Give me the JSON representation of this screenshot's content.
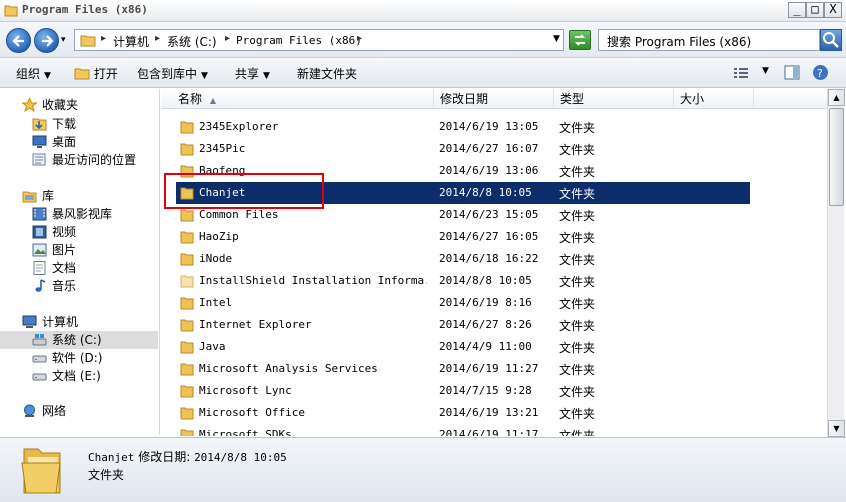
{
  "window": {
    "title": "Program Files (x86)",
    "buttons": {
      "minimize": "_",
      "maximize": "□",
      "close": "X"
    }
  },
  "address": {
    "crumbs": [
      "计算机",
      "系统 (C:)",
      "Program Files (x86)"
    ],
    "search_placeholder": "搜索 Program Files (x86)"
  },
  "toolbar": {
    "organize": "组织",
    "open": "打开",
    "include_in_library": "包含到库中",
    "share": "共享",
    "new_folder": "新建文件夹"
  },
  "nav": {
    "favorites": "收藏夹",
    "downloads": "下载",
    "desktop": "桌面",
    "recent": "最近访问的位置",
    "libraries": "库",
    "videos_lib": "暴风影视库",
    "video": "视频",
    "pictures": "图片",
    "documents": "文档",
    "music": "音乐",
    "computer": "计算机",
    "drive_c": "系统 (C:)",
    "drive_d": "软件 (D:)",
    "drive_e": "文档 (E:)",
    "network": "网络"
  },
  "columns": {
    "name": "名称",
    "modified": "修改日期",
    "type": "类型",
    "size": "大小"
  },
  "files": [
    {
      "name": "2345Explorer",
      "date": "2014/6/19 13:05",
      "type": "文件夹"
    },
    {
      "name": "2345Pic",
      "date": "2014/6/27 16:07",
      "type": "文件夹"
    },
    {
      "name": "Baofeng",
      "date": "2014/6/19 13:06",
      "type": "文件夹"
    },
    {
      "name": "Chanjet",
      "date": "2014/8/8 10:05",
      "type": "文件夹"
    },
    {
      "name": "Common Files",
      "date": "2014/6/23 15:05",
      "type": "文件夹"
    },
    {
      "name": "HaoZip",
      "date": "2014/6/27 16:05",
      "type": "文件夹"
    },
    {
      "name": "iNode",
      "date": "2014/6/18 16:22",
      "type": "文件夹"
    },
    {
      "name": "InstallShield Installation Informa...",
      "date": "2014/8/8 10:05",
      "type": "文件夹"
    },
    {
      "name": "Intel",
      "date": "2014/6/19 8:16",
      "type": "文件夹"
    },
    {
      "name": "Internet Explorer",
      "date": "2014/6/27 8:26",
      "type": "文件夹"
    },
    {
      "name": "Java",
      "date": "2014/4/9 11:00",
      "type": "文件夹"
    },
    {
      "name": "Microsoft Analysis Services",
      "date": "2014/6/19 11:27",
      "type": "文件夹"
    },
    {
      "name": "Microsoft Lync",
      "date": "2014/7/15 9:28",
      "type": "文件夹"
    },
    {
      "name": "Microsoft Office",
      "date": "2014/6/19 13:21",
      "type": "文件夹"
    },
    {
      "name": "Microsoft SDKs",
      "date": "2014/6/19 11:17",
      "type": "文件夹"
    }
  ],
  "details": {
    "name": "Chanjet",
    "modified_label": "修改日期:",
    "modified_value": "2014/8/8 10:05",
    "type": "文件夹"
  }
}
